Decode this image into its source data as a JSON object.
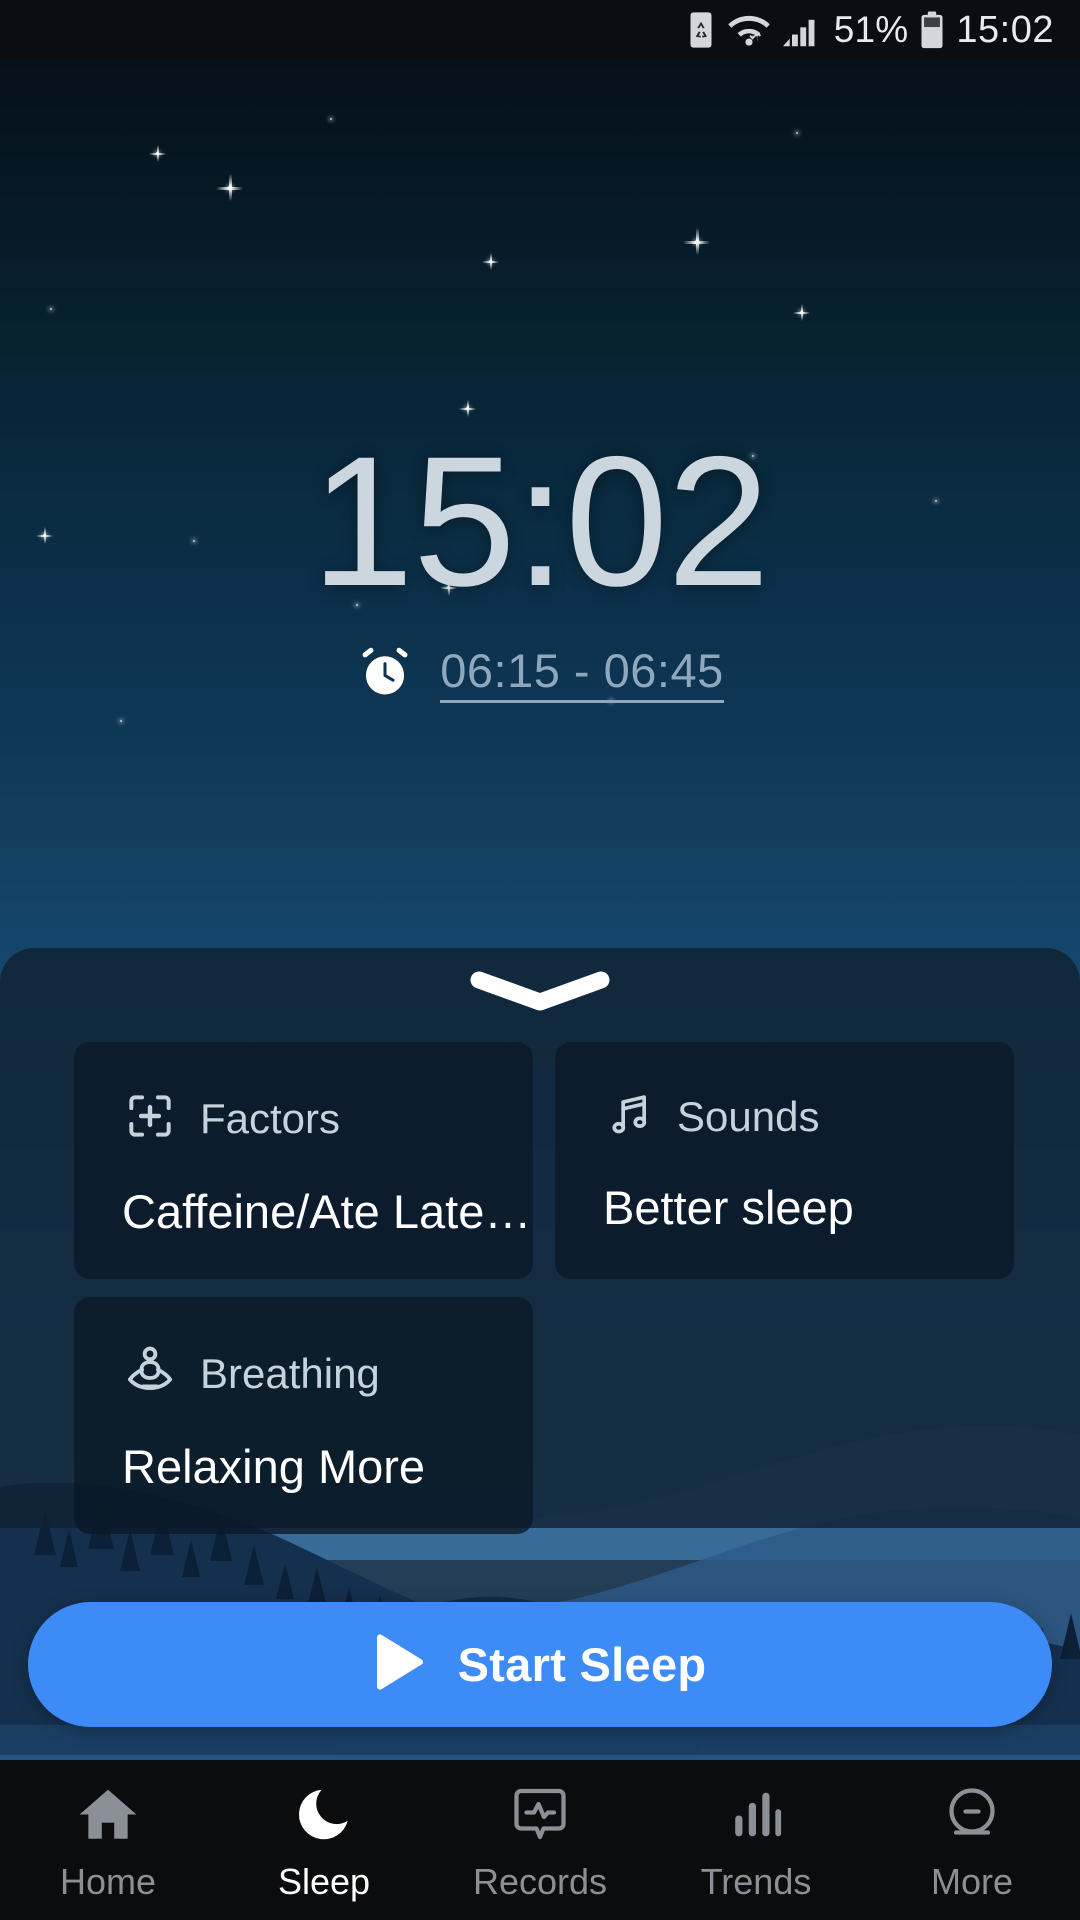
{
  "status_bar": {
    "icons": [
      "battery-saver-icon",
      "wifi-icon",
      "signal-icon",
      "battery-icon"
    ],
    "battery_percent": "51%",
    "clock": "15:02"
  },
  "sleep_screen": {
    "current_time": "15:02",
    "alarm_icon": "alarm-clock-icon",
    "alarm_window": "06:15 - 06:45",
    "sheet_handle": "chevron-down-handle",
    "cards": [
      {
        "icon": "add-factor-icon",
        "title": "Factors",
        "value": "Caffeine/Ate Late…"
      },
      {
        "icon": "music-note-icon",
        "title": "Sounds",
        "value": "Better sleep"
      },
      {
        "icon": "meditation-icon",
        "title": "Breathing",
        "value": "Relaxing More"
      }
    ],
    "start_button": {
      "icon": "play-icon",
      "label": "Start Sleep"
    }
  },
  "bottom_nav": {
    "items": [
      {
        "icon": "home-icon",
        "label": "Home",
        "active": false
      },
      {
        "icon": "moon-icon",
        "label": "Sleep",
        "active": true
      },
      {
        "icon": "records-icon",
        "label": "Records",
        "active": false
      },
      {
        "icon": "trends-icon",
        "label": "Trends",
        "active": false
      },
      {
        "icon": "more-icon",
        "label": "More",
        "active": false
      }
    ]
  },
  "colors": {
    "accent": "#3d8bf7",
    "sky_top": "#050e17",
    "sky_bottom": "#2d6590",
    "clock_text": "#ccd6de",
    "alarm_text": "#8fa8bd",
    "nav_inactive": "#8b9096",
    "nav_active": "#ffffff"
  }
}
